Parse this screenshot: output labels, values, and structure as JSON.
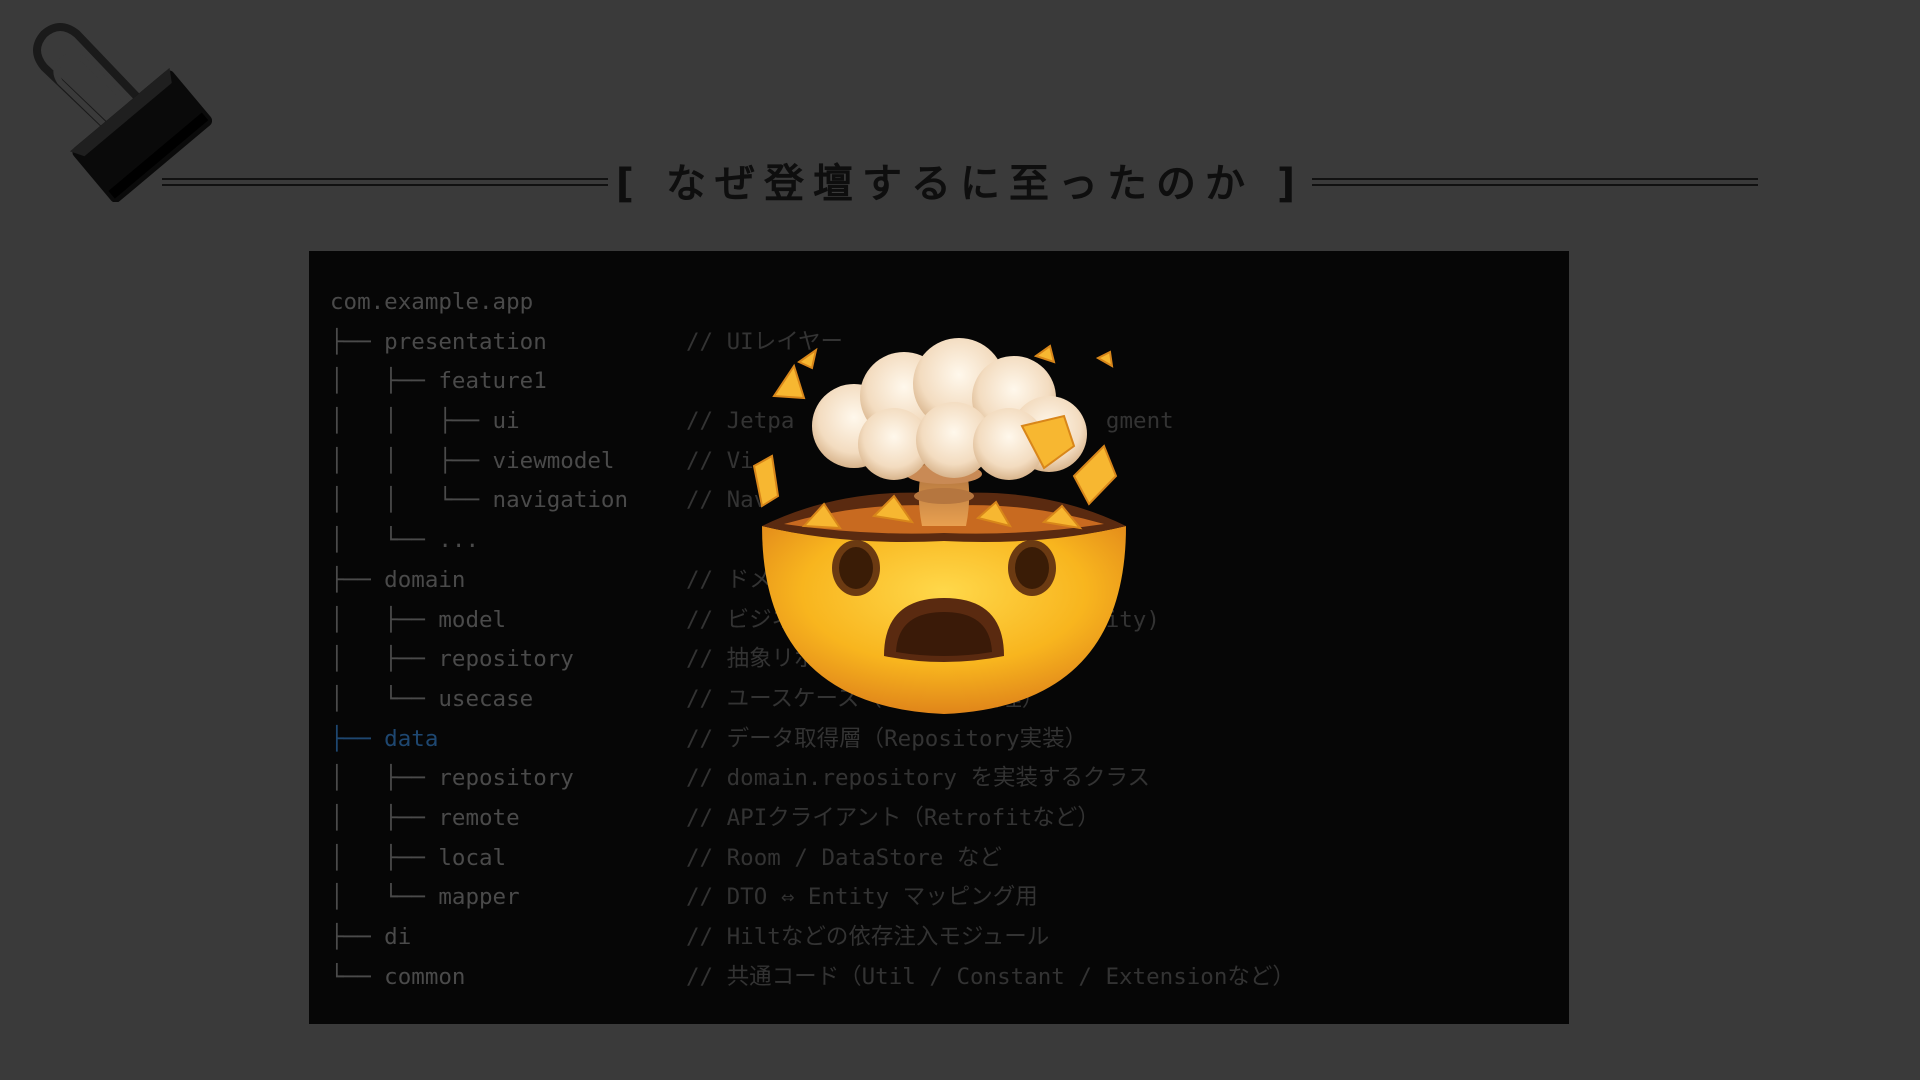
{
  "title": "[ なぜ登壇するに至ったのか ]",
  "code": {
    "lines": [
      {
        "tree": "com.example.app",
        "comment": ""
      },
      {
        "tree": "├── presentation",
        "comment": "// UIレイヤー"
      },
      {
        "tree": "│   ├── feature1",
        "comment": ""
      },
      {
        "tree": "│   │   ├── ui",
        "comment": "// Jetpa                       gment"
      },
      {
        "tree": "│   │   ├── viewmodel",
        "comment": "// Vi"
      },
      {
        "tree": "│   │   └── navigation",
        "comment": "// Nav"
      },
      {
        "tree": "│   └── ...",
        "comment": ""
      },
      {
        "tree": "├── domain",
        "comment": "// ドメ                     ー"
      },
      {
        "tree": "│   ├── model",
        "comment": "// ビジネ                   (Entity)"
      },
      {
        "tree": "│   ├── repository",
        "comment": "// 抽象リポ"
      },
      {
        "tree": "│   └── usecase",
        "comment": "// ユースケース（       処理）"
      },
      {
        "tree": "├── data",
        "comment": "// データ取得層（Repository実装）",
        "highlight": true
      },
      {
        "tree": "│   ├── repository",
        "comment": "// domain.repository を実装するクラス"
      },
      {
        "tree": "│   ├── remote",
        "comment": "// APIクライアント（Retrofitなど）"
      },
      {
        "tree": "│   ├── local",
        "comment": "// Room / DataStore など"
      },
      {
        "tree": "│   └── mapper",
        "comment": "// DTO ⇔ Entity マッピング用"
      },
      {
        "tree": "├── di",
        "comment": "// Hiltなどの依存注入モジュール"
      },
      {
        "tree": "└── common",
        "comment": "// 共通コード（Util / Constant / Extensionなど）"
      }
    ]
  },
  "emoji_icon": "exploding-head-emoji",
  "clip_icon": "binder-clip-icon",
  "colors": {
    "background": "#3a3a3a",
    "panel": "#060606",
    "title": "#0e0e0e",
    "highlight": "#1e4770"
  }
}
